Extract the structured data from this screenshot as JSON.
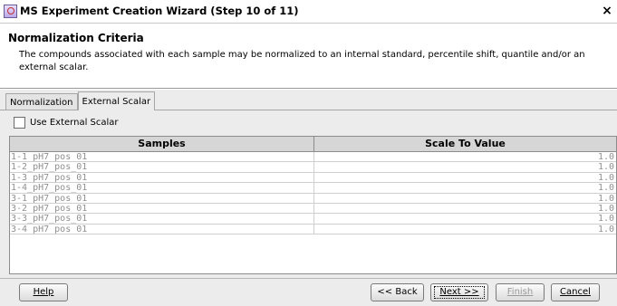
{
  "window": {
    "title": "MS Experiment Creation Wizard (Step 10 of 11)",
    "close_glyph": "×",
    "icon": "wizard-app-icon"
  },
  "header": {
    "title": "Normalization Criteria",
    "description": "The compounds associated with each sample may be normalized to an internal standard, percentile shift, quantile and/or an external scalar."
  },
  "tabs": [
    {
      "label": "Normalization",
      "active": false
    },
    {
      "label": "External Scalar",
      "active": true
    }
  ],
  "use_external_scalar": {
    "label": "Use External Scalar",
    "checked": false
  },
  "table": {
    "columns": [
      "Samples",
      "Scale To Value"
    ],
    "rows": [
      {
        "sample": "1-1_pH7_pos_01",
        "value": "1.0"
      },
      {
        "sample": "1-2_pH7_pos_01",
        "value": "1.0"
      },
      {
        "sample": "1-3_pH7_pos_01",
        "value": "1.0"
      },
      {
        "sample": "1-4_pH7_pos_01",
        "value": "1.0"
      },
      {
        "sample": "3-1_pH7_pos_01",
        "value": "1.0"
      },
      {
        "sample": "3-2_pH7_pos_01",
        "value": "1.0"
      },
      {
        "sample": "3-3_pH7_pos_01",
        "value": "1.0"
      },
      {
        "sample": "3-4_pH7_pos_01",
        "value": "1.0"
      }
    ]
  },
  "buttons": {
    "help": "Help",
    "back": "<< Back",
    "next": "Next >>",
    "finish": "Finish",
    "cancel": "Cancel"
  },
  "colors": {
    "panel_background": "#ececec",
    "header_background": "#ffffff",
    "disabled_text": "#9a9a9a"
  }
}
